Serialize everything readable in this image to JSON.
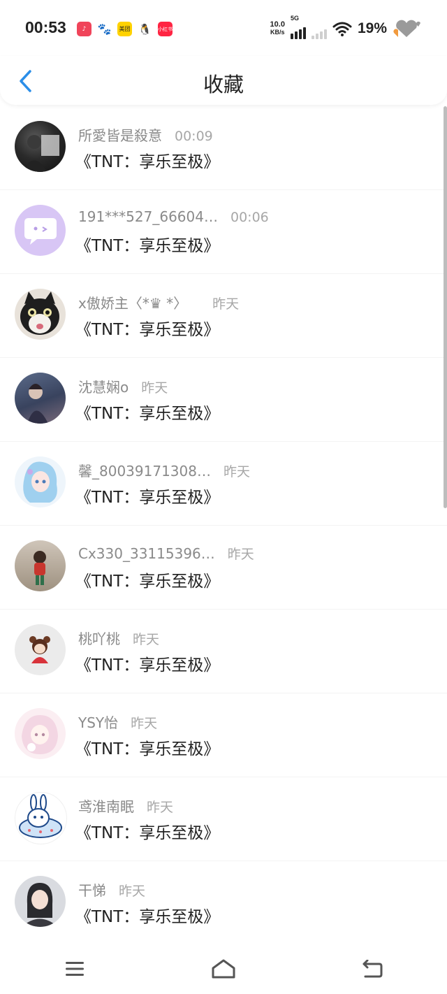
{
  "status_bar": {
    "time": "00:53",
    "net_speed_value": "10.0",
    "net_speed_unit": "KB/s",
    "network_type": "5G",
    "battery": "19%",
    "notification_icons": [
      "douyin-icon",
      "baidu-icon",
      "meituan-icon",
      "qq-icon",
      "xiaohongshu-icon"
    ],
    "notif_labels": {
      "meituan": "美团",
      "xhs": "小红书"
    }
  },
  "header": {
    "title": "收藏",
    "back_icon": "chevron-left-icon",
    "accent": "#2b8ee8"
  },
  "items": [
    {
      "user": "所愛皆是殺意",
      "time": "00:09",
      "work": "《TNT：享乐至极》"
    },
    {
      "user": "191***527_66604…",
      "time": "00:06",
      "work": "《TNT：享乐至极》"
    },
    {
      "user": "x傲娇主〈*♛ *〉",
      "time": "昨天",
      "work": "《TNT：享乐至极》"
    },
    {
      "user": "沈慧娴o",
      "time": "昨天",
      "work": "《TNT：享乐至极》"
    },
    {
      "user": "馨_80039171308…",
      "time": "昨天",
      "work": "《TNT：享乐至极》"
    },
    {
      "user": "Cx330_33115396…",
      "time": "昨天",
      "work": "《TNT：享乐至极》"
    },
    {
      "user": "桃吖桃",
      "time": "昨天",
      "work": "《TNT：享乐至极》"
    },
    {
      "user": "YSY怡",
      "time": "昨天",
      "work": "《TNT：享乐至极》"
    },
    {
      "user": "鸢淮南眠",
      "time": "昨天",
      "work": "《TNT：享乐至极》"
    },
    {
      "user": "干悌",
      "time": "昨天",
      "work": "《TNT：享乐至极》"
    }
  ],
  "bottom_nav": [
    "menu-icon",
    "home-icon",
    "back-icon"
  ]
}
